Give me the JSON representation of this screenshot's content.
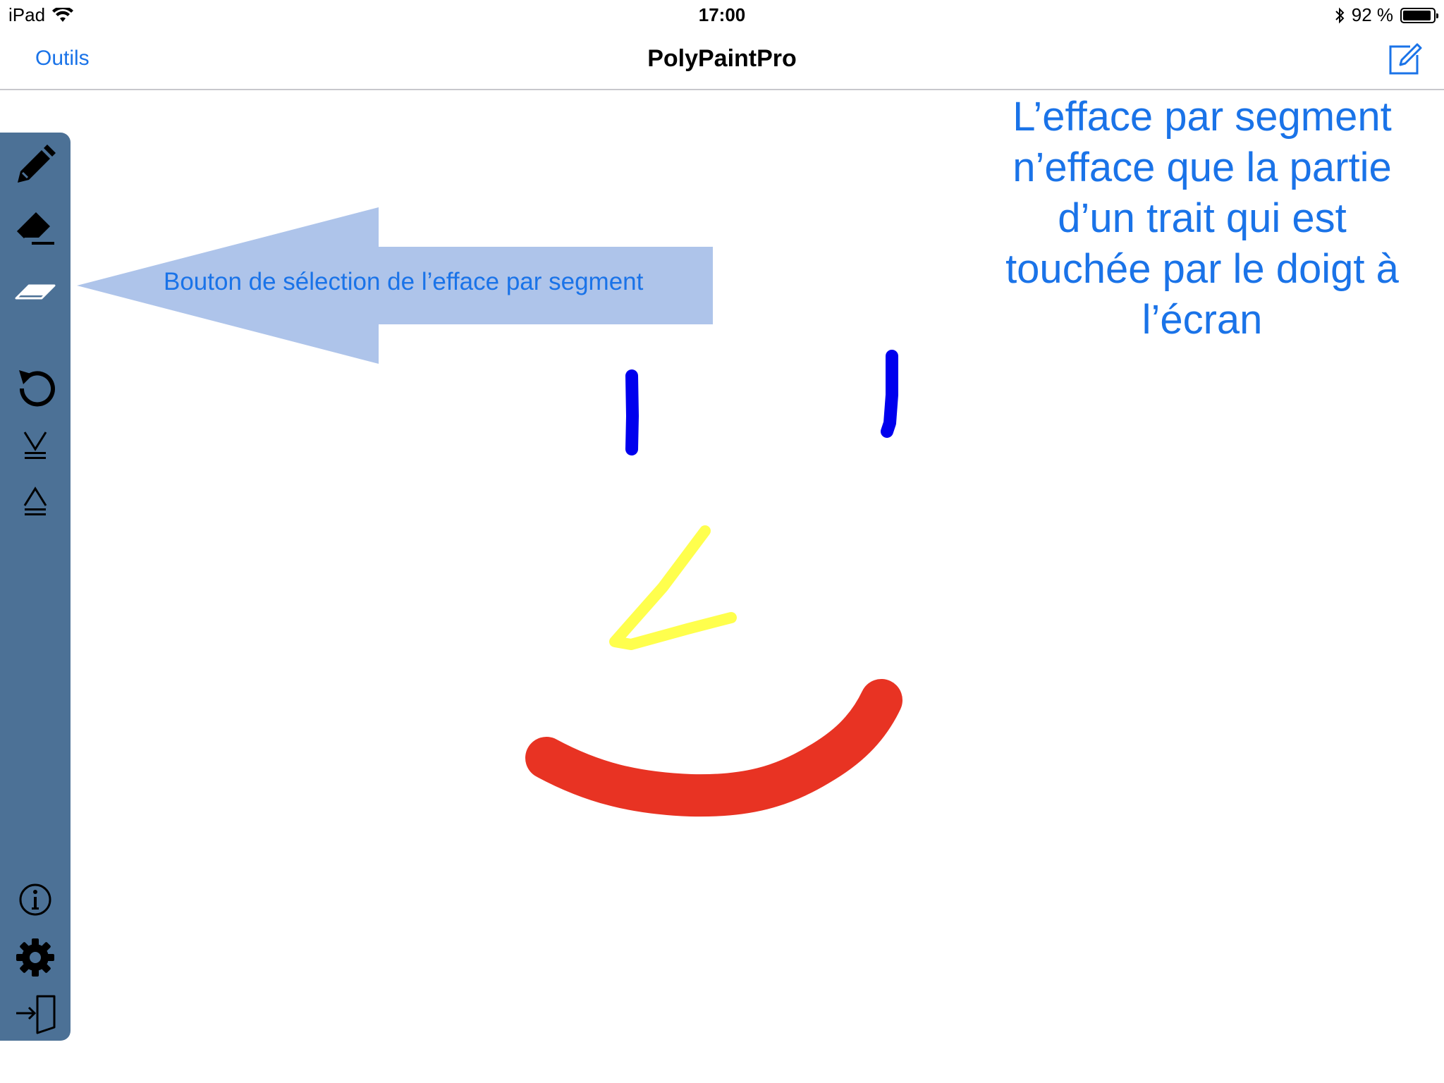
{
  "status_bar": {
    "device": "iPad",
    "time": "17:00",
    "battery_percent_text": "92 %",
    "battery_level": 0.92
  },
  "nav_bar": {
    "left_label": "Outils",
    "title": "PolyPaintPro",
    "right_icon": "compose-icon"
  },
  "toolbar": {
    "tools": [
      {
        "icon": "pencil-icon"
      },
      {
        "icon": "stroke-eraser-icon"
      },
      {
        "icon": "segment-eraser-icon"
      },
      {
        "icon": "undo-icon"
      },
      {
        "icon": "layer-down-icon"
      },
      {
        "icon": "layer-up-icon"
      },
      {
        "icon": "info-icon"
      },
      {
        "icon": "gear-icon"
      },
      {
        "icon": "exit-icon"
      }
    ],
    "background": "#4c7196"
  },
  "annotation": {
    "arrow_label": "Bouton de sélection de l’efface par segment",
    "arrow_color": "#aec4ea",
    "explanation_lines": [
      "L’efface par segment",
      "n’efface que la partie",
      "d’un trait qui est",
      "touchée par le doigt à",
      "l’écran"
    ],
    "text_color": "#1a73e8"
  },
  "strokes": [
    {
      "color": "#0000ee",
      "name": "blue-stroke-left"
    },
    {
      "color": "#0000ee",
      "name": "blue-stroke-right"
    },
    {
      "color": "#ffff4d",
      "name": "yellow-stroke"
    },
    {
      "color": "#e83323",
      "name": "red-stroke"
    }
  ]
}
